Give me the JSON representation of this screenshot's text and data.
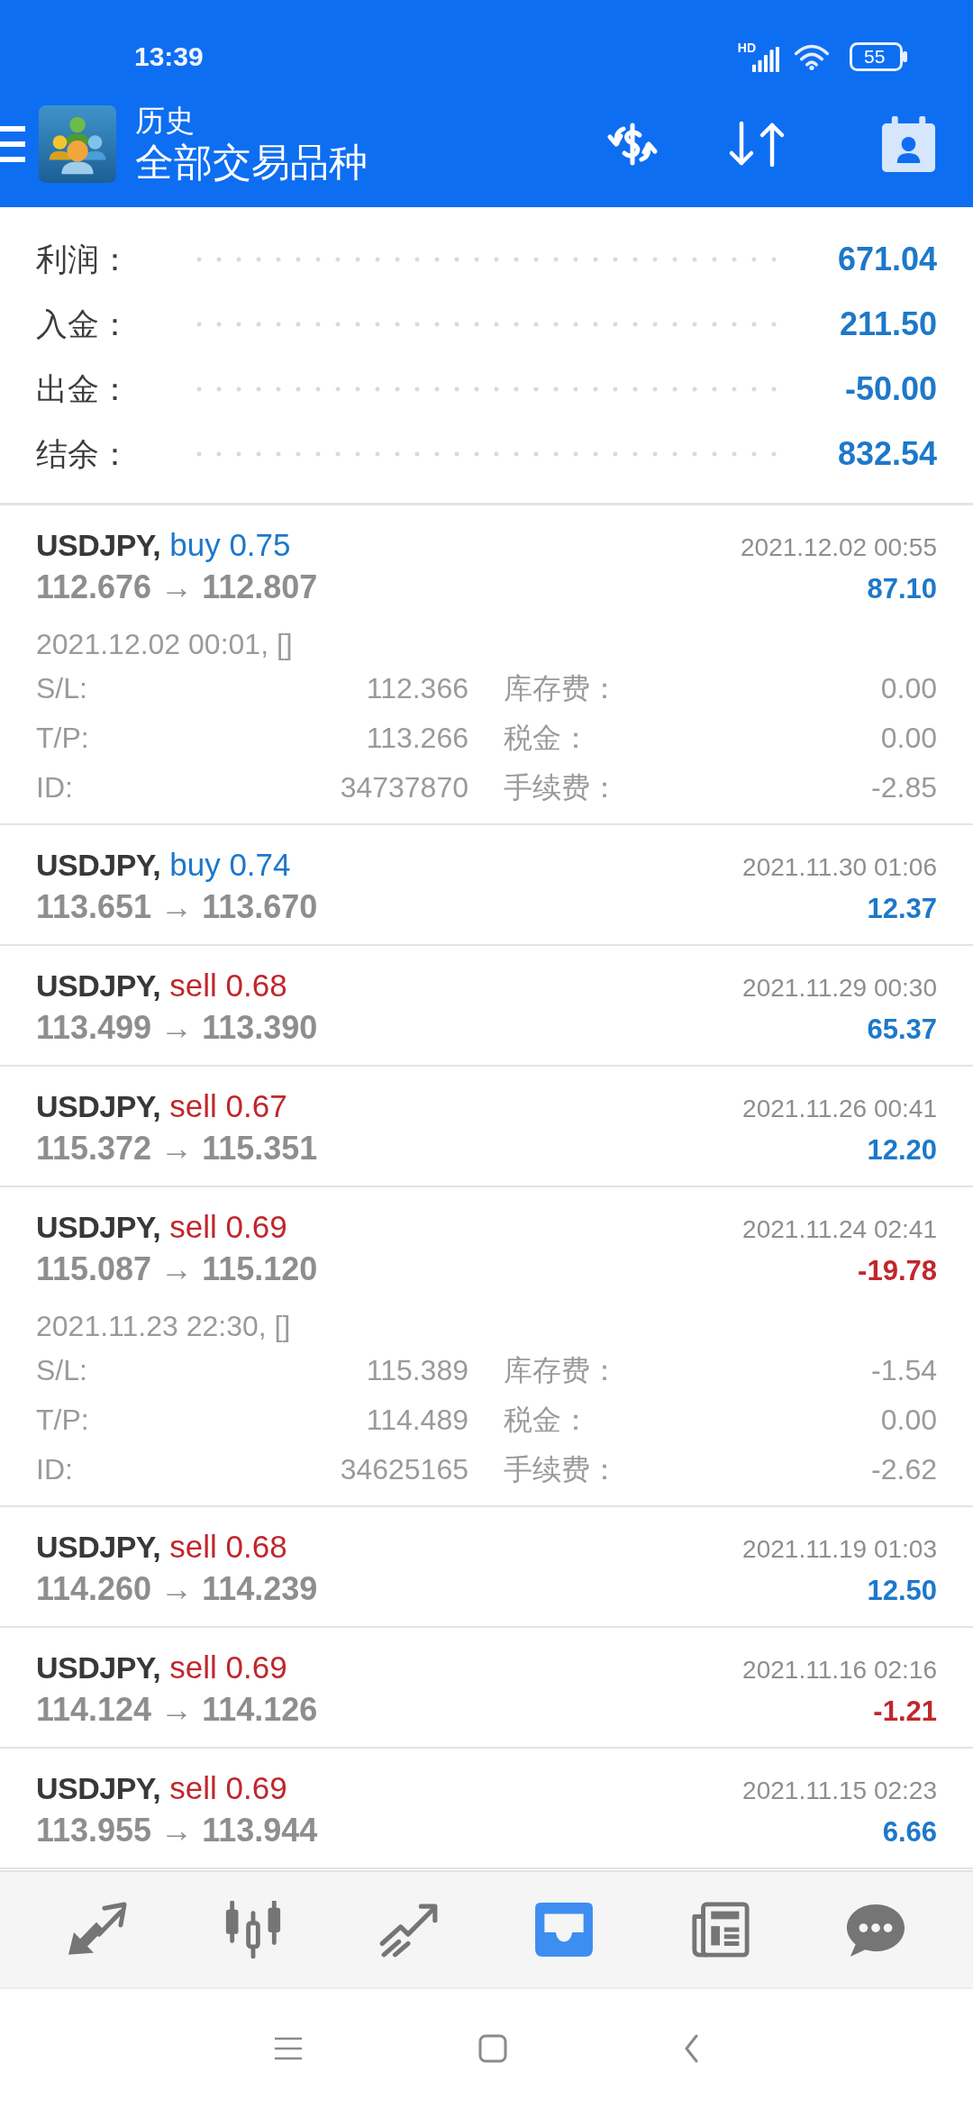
{
  "status_bar": {
    "time": "13:39",
    "network": "HD",
    "battery": "55"
  },
  "app_bar": {
    "title": "历史",
    "subtitle": "全部交易品种"
  },
  "summary": [
    {
      "label": "利润：",
      "value": "671.04"
    },
    {
      "label": "入金：",
      "value": "211.50"
    },
    {
      "label": "出金：",
      "value": "-50.00"
    },
    {
      "label": "结余：",
      "value": "832.54"
    }
  ],
  "trades": [
    {
      "symbol": "USDJPY,",
      "kind": "buy",
      "order": "buy 0.75",
      "prices": "112.676 → 112.807",
      "close_time": "2021.12.02 00:55",
      "profit": "87.10",
      "loss": false,
      "expanded": true,
      "open_info": "2021.12.02 00:01, []",
      "details": [
        {
          "label": "S/L:",
          "value": "112.366"
        },
        {
          "label": "库存费：",
          "value": "0.00"
        },
        {
          "label": "T/P:",
          "value": "113.266"
        },
        {
          "label": "税金：",
          "value": "0.00"
        },
        {
          "label": "ID:",
          "value": "34737870"
        },
        {
          "label": "手续费：",
          "value": "-2.85"
        }
      ]
    },
    {
      "symbol": "USDJPY,",
      "kind": "buy",
      "order": "buy 0.74",
      "prices": "113.651 → 113.670",
      "close_time": "2021.11.30 01:06",
      "profit": "12.37",
      "loss": false,
      "expanded": false
    },
    {
      "symbol": "USDJPY,",
      "kind": "sell",
      "order": "sell 0.68",
      "prices": "113.499 → 113.390",
      "close_time": "2021.11.29 00:30",
      "profit": "65.37",
      "loss": false,
      "expanded": false
    },
    {
      "symbol": "USDJPY,",
      "kind": "sell",
      "order": "sell 0.67",
      "prices": "115.372 → 115.351",
      "close_time": "2021.11.26 00:41",
      "profit": "12.20",
      "loss": false,
      "expanded": false
    },
    {
      "symbol": "USDJPY,",
      "kind": "sell",
      "order": "sell 0.69",
      "prices": "115.087 → 115.120",
      "close_time": "2021.11.24 02:41",
      "profit": "-19.78",
      "loss": true,
      "expanded": true,
      "open_info": "2021.11.23 22:30, []",
      "details": [
        {
          "label": "S/L:",
          "value": "115.389"
        },
        {
          "label": "库存费：",
          "value": "-1.54"
        },
        {
          "label": "T/P:",
          "value": "114.489"
        },
        {
          "label": "税金：",
          "value": "0.00"
        },
        {
          "label": "ID:",
          "value": "34625165"
        },
        {
          "label": "手续费：",
          "value": "-2.62"
        }
      ]
    },
    {
      "symbol": "USDJPY,",
      "kind": "sell",
      "order": "sell 0.68",
      "prices": "114.260 → 114.239",
      "close_time": "2021.11.19 01:03",
      "profit": "12.50",
      "loss": false,
      "expanded": false
    },
    {
      "symbol": "USDJPY,",
      "kind": "sell",
      "order": "sell 0.69",
      "prices": "114.124 → 114.126",
      "close_time": "2021.11.16 02:16",
      "profit": "-1.21",
      "loss": true,
      "expanded": false
    },
    {
      "symbol": "USDJPY,",
      "kind": "sell",
      "order": "sell 0.69",
      "prices": "113.955 → 113.944",
      "close_time": "2021.11.15 02:23",
      "profit": "6.66",
      "loss": false,
      "expanded": false
    }
  ],
  "bottom_nav": [
    {
      "kind": "arrows",
      "selected": false
    },
    {
      "kind": "candles",
      "selected": false
    },
    {
      "kind": "trend",
      "selected": false
    },
    {
      "kind": "inbox",
      "selected": true
    },
    {
      "kind": "newspaper",
      "selected": false
    },
    {
      "kind": "chat",
      "selected": false
    }
  ]
}
